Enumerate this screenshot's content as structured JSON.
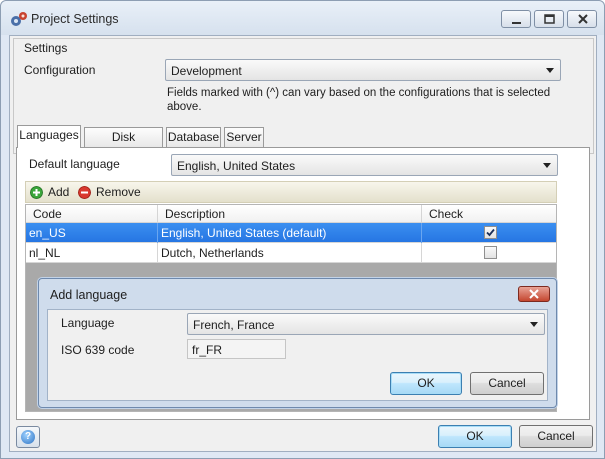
{
  "window": {
    "title": "Project Settings"
  },
  "settings": {
    "group_label": "Settings",
    "configuration_label": "Configuration",
    "configuration_value": "Development",
    "note": "Fields marked with (^) can vary based on the configurations that is selected above."
  },
  "tabs": [
    {
      "label": "Languages",
      "active": true
    },
    {
      "label": "Disk Locations",
      "active": false
    },
    {
      "label": "Database",
      "active": false
    },
    {
      "label": "Server",
      "active": false
    }
  ],
  "languages": {
    "default_label": "Default language",
    "default_value": "English, United States",
    "add_label": "Add",
    "remove_label": "Remove",
    "columns": [
      "Code",
      "Description",
      "Check"
    ],
    "rows": [
      {
        "code": "en_US",
        "description": "English, United States (default)",
        "checked": true,
        "selected": true
      },
      {
        "code": "nl_NL",
        "description": "Dutch, Netherlands",
        "checked": false,
        "selected": false
      }
    ]
  },
  "dialog": {
    "title": "Add language",
    "language_label": "Language",
    "language_value": "French, France",
    "iso_label": "ISO 639 code",
    "iso_value": "fr_FR",
    "ok_label": "OK",
    "cancel_label": "Cancel"
  },
  "footer": {
    "ok_label": "OK",
    "cancel_label": "Cancel",
    "help_icon": "help-icon"
  },
  "colors": {
    "selection": "#2f80ea",
    "add_icon": "#3aa63a",
    "remove_icon": "#d9392f"
  }
}
